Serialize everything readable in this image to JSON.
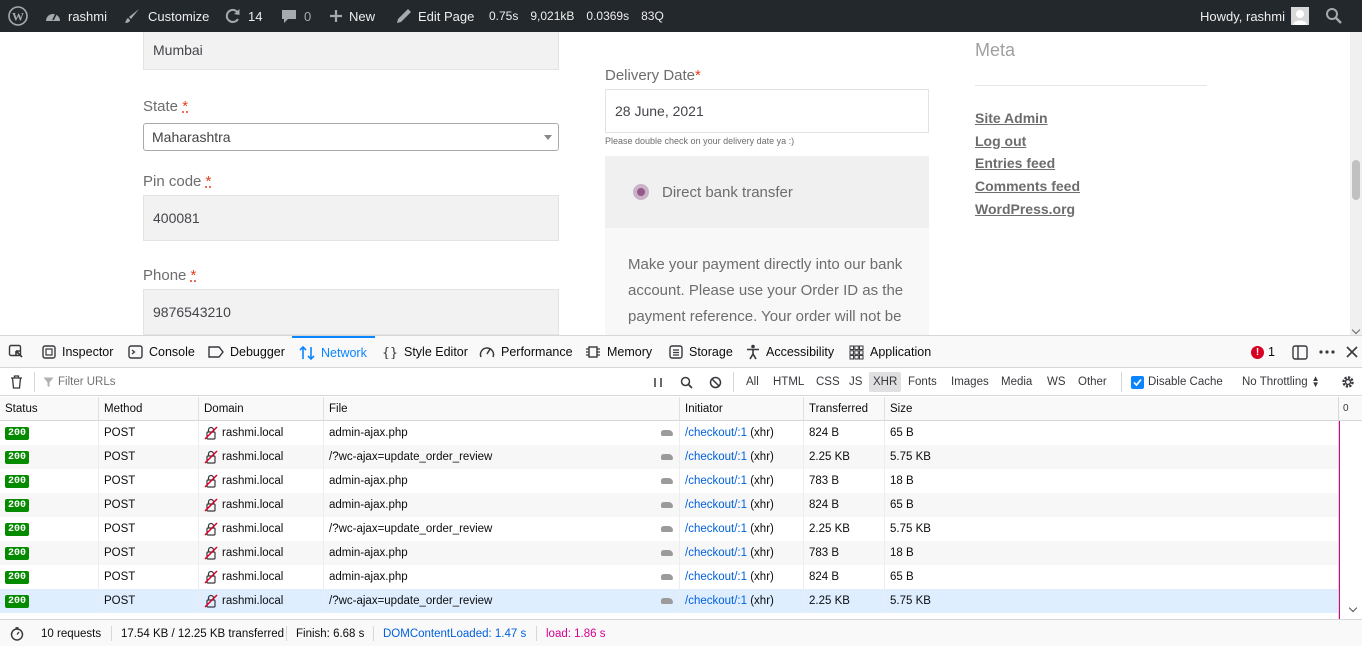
{
  "adminbar": {
    "site_name": "rashmi",
    "customize": "Customize",
    "updates_count": "14",
    "comments_count": "0",
    "new_label": "New",
    "edit_page": "Edit Page",
    "stat_time": "0.75s",
    "stat_memory": "9,021kB",
    "stat_query_time": "0.0369s",
    "stat_queries": "83Q",
    "howdy": "Howdy, rashmi"
  },
  "form": {
    "city_value": "Mumbai",
    "state_label": "State",
    "state_value": "Maharashtra",
    "pin_label": "Pin code",
    "pin_value": "400081",
    "phone_label": "Phone",
    "phone_value": "9876543210",
    "required_mark": "*",
    "delivery_label": "Delivery Date",
    "delivery_value": "28 June, 2021",
    "delivery_hint": "Please double check on your delivery date ya :)",
    "payment_option": "Direct bank transfer",
    "payment_desc": "Make your payment directly into our bank account. Please use your Order ID as the payment reference. Your order will not be"
  },
  "meta": {
    "title": "Meta",
    "links": [
      "Site Admin",
      "Log out",
      "Entries feed",
      "Comments feed",
      "WordPress.org"
    ]
  },
  "devtools": {
    "tabs": [
      "Inspector",
      "Console",
      "Debugger",
      "Network",
      "Style Editor",
      "Performance",
      "Memory",
      "Storage",
      "Accessibility",
      "Application"
    ],
    "error_count": "1",
    "filter_placeholder": "Filter URLs",
    "type_filters": [
      "All",
      "HTML",
      "CSS",
      "JS",
      "XHR",
      "Fonts",
      "Images",
      "Media",
      "WS",
      "Other"
    ],
    "disable_cache": "Disable Cache",
    "throttling": "No Throttling",
    "columns": [
      "Status",
      "Method",
      "Domain",
      "File",
      "Initiator",
      "Transferred",
      "Size"
    ],
    "timeline_tick": "0",
    "requests": [
      {
        "status": "200",
        "method": "POST",
        "domain": "rashmi.local",
        "file": "admin-ajax.php",
        "initiator": "/checkout/:1",
        "cause": "(xhr)",
        "transferred": "824 B",
        "size": "65 B"
      },
      {
        "status": "200",
        "method": "POST",
        "domain": "rashmi.local",
        "file": "/?wc-ajax=update_order_review",
        "initiator": "/checkout/:1",
        "cause": "(xhr)",
        "transferred": "2.25 KB",
        "size": "5.75 KB"
      },
      {
        "status": "200",
        "method": "POST",
        "domain": "rashmi.local",
        "file": "admin-ajax.php",
        "initiator": "/checkout/:1",
        "cause": "(xhr)",
        "transferred": "783 B",
        "size": "18 B"
      },
      {
        "status": "200",
        "method": "POST",
        "domain": "rashmi.local",
        "file": "admin-ajax.php",
        "initiator": "/checkout/:1",
        "cause": "(xhr)",
        "transferred": "824 B",
        "size": "65 B"
      },
      {
        "status": "200",
        "method": "POST",
        "domain": "rashmi.local",
        "file": "/?wc-ajax=update_order_review",
        "initiator": "/checkout/:1",
        "cause": "(xhr)",
        "transferred": "2.25 KB",
        "size": "5.75 KB"
      },
      {
        "status": "200",
        "method": "POST",
        "domain": "rashmi.local",
        "file": "admin-ajax.php",
        "initiator": "/checkout/:1",
        "cause": "(xhr)",
        "transferred": "783 B",
        "size": "18 B"
      },
      {
        "status": "200",
        "method": "POST",
        "domain": "rashmi.local",
        "file": "admin-ajax.php",
        "initiator": "/checkout/:1",
        "cause": "(xhr)",
        "transferred": "824 B",
        "size": "65 B"
      },
      {
        "status": "200",
        "method": "POST",
        "domain": "rashmi.local",
        "file": "/?wc-ajax=update_order_review",
        "initiator": "/checkout/:1",
        "cause": "(xhr)",
        "transferred": "2.25 KB",
        "size": "5.75 KB"
      }
    ],
    "summary": {
      "requests": "10 requests",
      "transferred": "17.54 KB / 12.25 KB transferred",
      "finish": "Finish: 6.68 s",
      "dcl": "DOMContentLoaded: 1.47 s",
      "load": "load: 1.86 s"
    }
  },
  "colors": {
    "accent": "#0a84ff",
    "status_ok": "#058b00",
    "radio": "#96588a",
    "load": "#d7008f"
  }
}
